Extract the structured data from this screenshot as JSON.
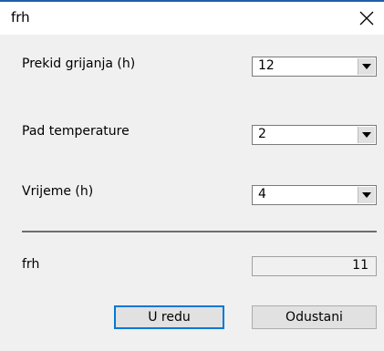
{
  "window": {
    "title": "frh"
  },
  "fields": [
    {
      "label": "Prekid grijanja (h)",
      "value": "12"
    },
    {
      "label": "Pad temperature",
      "value": "2"
    },
    {
      "label": "Vrijeme (h)",
      "value": "4"
    }
  ],
  "result": {
    "label": "frh",
    "value": "11"
  },
  "buttons": {
    "ok": "U redu",
    "cancel": "Odustani"
  },
  "icons": {
    "close": "close-icon",
    "dropdown": "chevron-down-icon"
  },
  "colors": {
    "accent": "#0078d7",
    "window_bg": "#f0f0f0",
    "titlebar_bg": "#ffffff"
  }
}
